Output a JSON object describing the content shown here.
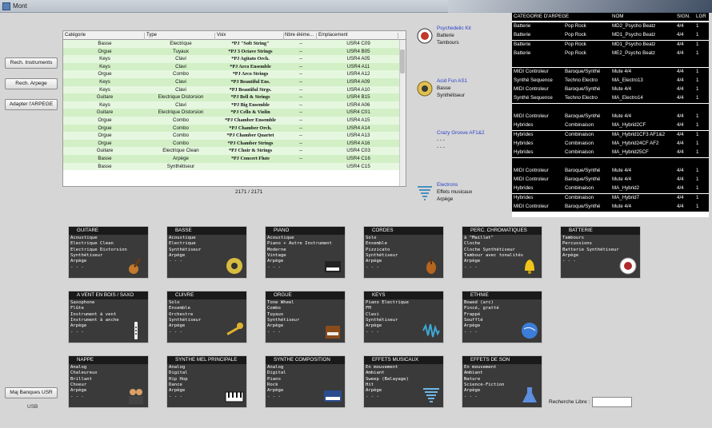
{
  "window": {
    "title": "Mont"
  },
  "buttons": {
    "rech_instruments": "Rech. Instruments",
    "rech_arpege": "Rech. Arpege",
    "adapter": "Adapter l'ARPEGE",
    "maj": "Maj Banques USR"
  },
  "grid": {
    "headers": [
      "Catégorie",
      "Type",
      "Voix",
      "Nbre éléme...",
      "Emplacement"
    ],
    "rows": [
      [
        "Basse",
        "Electrique",
        "*PJ \"Soft String\"",
        "--",
        "USR4 C09"
      ],
      [
        "Orgue",
        "Tuyaux",
        "*PJ 3 Octave Strings",
        "--",
        "USR4 B05"
      ],
      [
        "Keys",
        "Clavi",
        "*PJ Agitato Orch.",
        "--",
        "USR4 A05"
      ],
      [
        "Keys",
        "Clavi",
        "*PJ Arco Ensemble",
        "--",
        "USR4 A11"
      ],
      [
        "Orgue",
        "Combo",
        "*PJ Arco Strings",
        "--",
        "USR4 A12"
      ],
      [
        "Keys",
        "Clavi",
        "*PJ Beautiful Ens.",
        "--",
        "USR4 A09"
      ],
      [
        "Keys",
        "Clavi",
        "*PJ Beautiful Strgs.",
        "--",
        "USR4 A10"
      ],
      [
        "Guitare",
        "Electrique Distorsion",
        "*PJ Bell & Strings",
        "--",
        "USR4 B15"
      ],
      [
        "Keys",
        "Clavi",
        "*PJ Big Ensemble",
        "--",
        "USR4 A06"
      ],
      [
        "Guitare",
        "Electrique Distorsion",
        "*PJ Cello & Violin",
        "--",
        "USR4 C01"
      ],
      [
        "Orgue",
        "Combo",
        "*PJ Chamber Ensemble",
        "--",
        "USR4 A15"
      ],
      [
        "Orgue",
        "Combo",
        "*PJ Chamber Orch.",
        "--",
        "USR4 A14"
      ],
      [
        "Orgue",
        "Combo",
        "*PJ Chamber Quartet",
        "--",
        "USR4 A13"
      ],
      [
        "Orgue",
        "Combo",
        "*PJ Chamber Strings",
        "--",
        "USR4 A16"
      ],
      [
        "Guitare",
        "Electrique Clean",
        "*PJ Choir & Strings",
        "--",
        "USR4 C03"
      ],
      [
        "Basse",
        "Arpège",
        "*PJ Concert Flute",
        "--",
        "USR4 C16"
      ],
      [
        "Basse",
        "Synthétiseur",
        "",
        "",
        "USR4 C15"
      ]
    ],
    "count": "2171 / 2171"
  },
  "kits": [
    {
      "name": "Psychedelic Kit",
      "l1": "Batterie",
      "l2": "Tambours"
    },
    {
      "name": "Acid Fun AS1",
      "l1": "Basse",
      "l2": "Synthétiseur"
    },
    {
      "name": "Crazy Groove AF1&2",
      "l1": "- - -",
      "l2": "- - -"
    },
    {
      "name": "Electrons",
      "l1": "Effets musicaux",
      "l2": "Arpège"
    }
  ],
  "arpeges": {
    "headers": [
      "CATEGORIE D'ARPEGE",
      "NOM",
      "SIGN.",
      "LGR"
    ],
    "rows": [
      [
        "Batterie",
        "Pop Rock",
        "MD2_Psycho Beatz",
        "4/4",
        "1"
      ],
      [
        "Batterie",
        "Pop Rock",
        "MD1_Psycho Beatz",
        "4/4",
        "1"
      ],
      [
        "Batterie",
        "Pop Rock",
        "MD1_Psycho Beatz",
        "4/4",
        "1"
      ],
      [
        "Batterie",
        "Pop Rock",
        "ME2_Psycho Beatz",
        "4/4",
        "1"
      ],
      [
        "",
        "",
        "",
        "",
        ""
      ],
      [
        "MIDI Controleur",
        "Baroque/Synthé",
        "Mute 4/4",
        "4/4",
        "1"
      ],
      [
        "Synthé Sequence",
        "Techno Electro",
        "MA_Electro13",
        "4/4",
        "1"
      ],
      [
        "MIDI Controleur",
        "Baroque/Synthé",
        "Mute 4/4",
        "4/4",
        "1"
      ],
      [
        "Synthé Sequence",
        "Techno Electro",
        "MA_Electro14",
        "4/4",
        "1"
      ],
      [
        "",
        "",
        "",
        "",
        ""
      ],
      [
        "MIDI Controleur",
        "Baroque/Synthé",
        "Mute 4/4",
        "4/4",
        "1"
      ],
      [
        "Hybrides",
        "Combinaison",
        "MA_Hybrid2CF",
        "4/4",
        "1"
      ],
      [
        "Hybrides",
        "Combinaison",
        "MA_Hybrid1CF3 AF1&2",
        "4/4",
        "1"
      ],
      [
        "Hybrides",
        "Combinaison",
        "MA_Hybrid24CF AF2",
        "4/4",
        "1"
      ],
      [
        "Hybrides",
        "Combinaison",
        "MA_Hybrid25CF",
        "4/4",
        "1"
      ],
      [
        "",
        "",
        "",
        "",
        ""
      ],
      [
        "MIDI Controleur",
        "Baroque/Synthé",
        "Mute 4/4",
        "4/4",
        "1"
      ],
      [
        "MIDI Controleur",
        "Baroque/Synthé",
        "Mute 4/4",
        "4/4",
        "1"
      ],
      [
        "Hybrides",
        "Combinaison",
        "MA_Hybrid2",
        "4/4",
        "1"
      ],
      [
        "Hybrides",
        "Combinaison",
        "MA_Hybrid7",
        "4/4",
        "1"
      ],
      [
        "MIDI Controleur",
        "Baroque/Synthé",
        "Mute 4/4",
        "4/4",
        "1"
      ]
    ]
  },
  "categories": [
    {
      "title": "GUITARE",
      "lines": [
        "Acoustique",
        "Electrique Clean",
        "Electrique Distorsion",
        "Synthétiseur",
        "Arpège",
        "- - -"
      ],
      "icon": "guitar-icon"
    },
    {
      "title": "BASSE",
      "lines": [
        "Acoustique",
        "Electrique",
        "Synthétiseur",
        "Arpège",
        "- - -"
      ],
      "icon": "speaker-icon"
    },
    {
      "title": "PIANO",
      "lines": [
        "Acoustique",
        "Piano + Autre Instrument",
        "Moderne",
        "Vintage",
        "Arpège",
        "- - -"
      ],
      "icon": "piano-icon"
    },
    {
      "title": "CORDES",
      "lines": [
        "Solo",
        "Ensemble",
        "Pizzicato",
        "Synthétiseur",
        "Arpège",
        "- - -"
      ],
      "icon": "violin-icon"
    },
    {
      "title": "PERC. CHROMATIQUES",
      "lines": [
        "à \"Maillet\"",
        "Cloche",
        "Cloche Synthétiseur",
        "Tambour avec tonalités",
        "Arpège",
        "- - -"
      ],
      "icon": "bell-icon"
    },
    {
      "title": "BATTERIE",
      "lines": [
        "Tambours",
        "Percussions",
        "Batterie Synthétiseur",
        "Arpège",
        "- - -"
      ],
      "icon": "drum-icon"
    },
    {
      "title": "A VENT EN BOIS / SAXO",
      "lines": [
        "Saxophone",
        "Flûte",
        "Instrument à vent",
        "Instrument à anche",
        "Arpège",
        "- - -"
      ],
      "icon": "flute-icon"
    },
    {
      "title": "CUIVRE",
      "lines": [
        "Solo",
        "Ensemble",
        "Orchestre",
        "Synthétiseur",
        "Arpège",
        "- - -"
      ],
      "icon": "trombone-icon"
    },
    {
      "title": "ORGUE",
      "lines": [
        "Tone Wheel",
        "Combo",
        "Tuyaux",
        "Synthétiseur",
        "Arpège",
        "- - -"
      ],
      "icon": "organ-icon"
    },
    {
      "title": "KEYS",
      "lines": [
        "Piano Electrique",
        "FM",
        "Clavi",
        "Synthétiseur",
        "Arpège",
        "- - -"
      ],
      "icon": "waveform-icon"
    },
    {
      "title": "ETHNIE",
      "lines": [
        "Bowed (arc)",
        "Pincé, gratté",
        "Frappé",
        "Soufflé",
        "Arpège",
        "- - -"
      ],
      "icon": "globe-icon"
    },
    {
      "title": "NAPPE",
      "lines": [
        "Analog",
        "Chaleureux",
        "Brillant",
        "Choeur",
        "Arpège",
        "- - -"
      ],
      "icon": "choir-icon"
    },
    {
      "title": "SYNTHE MEL PRINCIPALE",
      "lines": [
        "Analog",
        "Digital",
        "Hip Hop",
        "Dance",
        "Arpège",
        "- - -"
      ],
      "icon": "keyboard-icon"
    },
    {
      "title": "SYNTHE COMPOSITION",
      "lines": [
        "Analog",
        "Digital",
        "Piano",
        "Rock",
        "Arpège",
        "- - -"
      ],
      "icon": "synth-icon"
    },
    {
      "title": "EFFETS MUSICAUX",
      "lines": [
        "En mouvement",
        "Ambiant",
        "Sweep (Balayage)",
        "Hit",
        "Arpège",
        "- - -"
      ],
      "icon": "tornado-icon"
    },
    {
      "title": "EFFETS DE SON",
      "lines": [
        "En mouvement",
        "Ambiant",
        "Nature",
        "Science-Fiction",
        "Arpège",
        "- - -"
      ],
      "icon": "flask-icon"
    }
  ],
  "search": {
    "label": "Recherche Libre :",
    "value": ""
  },
  "status": {
    "usb": "USB"
  },
  "colors": {
    "row_even": "#e6f7e0",
    "row_odd": "#d2efc6",
    "selected": "#cfe9c2"
  }
}
